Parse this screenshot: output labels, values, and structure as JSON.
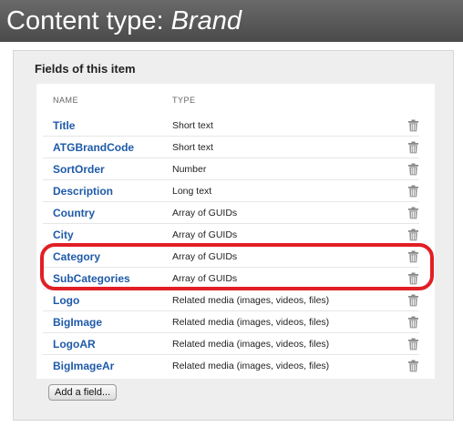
{
  "header": {
    "prefix": "Content type: ",
    "name": "Brand"
  },
  "section": {
    "title": "Fields of this item"
  },
  "table": {
    "columns": [
      "NAME",
      "TYPE"
    ],
    "rows": [
      {
        "name": "Title",
        "type": "Short text"
      },
      {
        "name": "ATGBrandCode",
        "type": "Short text"
      },
      {
        "name": "SortOrder",
        "type": "Number"
      },
      {
        "name": "Description",
        "type": "Long text"
      },
      {
        "name": "Country",
        "type": "Array of GUIDs"
      },
      {
        "name": "City",
        "type": "Array of GUIDs"
      },
      {
        "name": "Category",
        "type": "Array of GUIDs"
      },
      {
        "name": "SubCategories",
        "type": "Array of GUIDs"
      },
      {
        "name": "Logo",
        "type": "Related media (images, videos, files)"
      },
      {
        "name": "BigImage",
        "type": "Related media (images, videos, files)"
      },
      {
        "name": "LogoAR",
        "type": "Related media (images, videos, files)"
      },
      {
        "name": "BigImageAr",
        "type": "Related media (images, videos, files)"
      }
    ]
  },
  "actions": {
    "add_field_label": "Add a field..."
  },
  "icons": {
    "delete": "trash-icon"
  },
  "colors": {
    "link": "#1e5aa8",
    "highlight": "#e11f25",
    "header_bg": "#5a5a5a"
  }
}
